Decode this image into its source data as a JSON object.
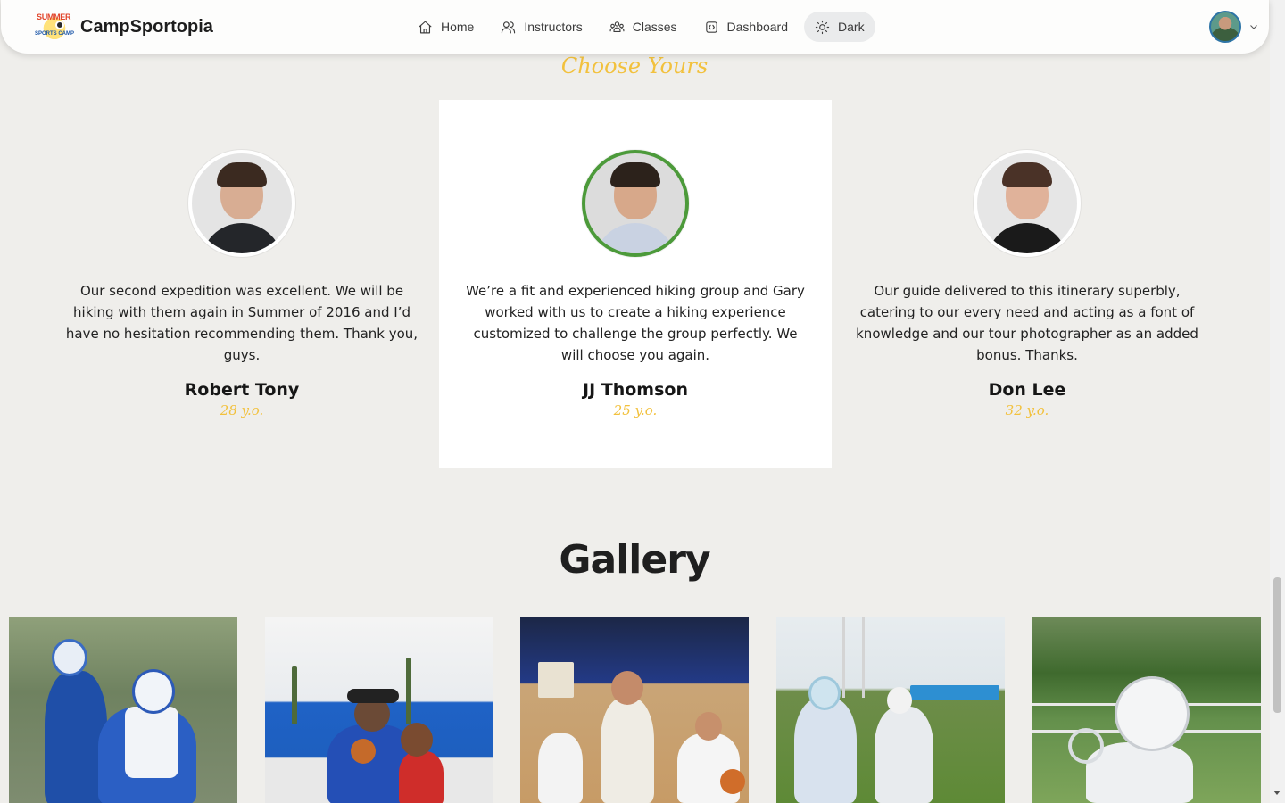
{
  "brand": {
    "logo_top_text": "SUMMER",
    "logo_bottom_text": "SPORTS CAMP",
    "name": "CampSportopia"
  },
  "nav": {
    "items": [
      {
        "label": "Home",
        "icon": "home-icon"
      },
      {
        "label": "Instructors",
        "icon": "users-icon"
      },
      {
        "label": "Classes",
        "icon": "group-icon"
      },
      {
        "label": "Dashboard",
        "icon": "dashboard-icon"
      },
      {
        "label": "Dark",
        "icon": "sun-icon"
      }
    ]
  },
  "user": {
    "avatar": "user-avatar",
    "menu_icon": "chevron-down-icon"
  },
  "testimonials": {
    "kicker": "Choose Yours",
    "items": [
      {
        "quote": "Our second expedition was excellent. We will be hiking with them again in Summer of 2016 and I’d have no hesitation recommending them. Thank you, guys.",
        "name": "Robert Tony",
        "age": "28 y.o."
      },
      {
        "quote": "We’re a fit and experienced hiking group and Gary worked with us to create a hiking experience customized to challenge the group perfectly. We will choose you again.",
        "name": "JJ Thomson",
        "age": "25 y.o."
      },
      {
        "quote": "Our guide delivered to this itinerary superbly, catering to our every need and acting as a font of knowledge and our tour photographer as an added bonus. Thanks.",
        "name": "Don Lee",
        "age": "32 y.o."
      }
    ]
  },
  "gallery": {
    "title": "Gallery",
    "images": [
      "lacrosse-players-photo",
      "coach-basketball-photo",
      "indoor-basketball-photo",
      "lacrosse-field-photo",
      "lacrosse-helmet-photo"
    ]
  },
  "colors": {
    "accent_gold": "#f2c13d",
    "featured_ring": "#4c9a3a",
    "page_bg": "#efeeeb"
  }
}
